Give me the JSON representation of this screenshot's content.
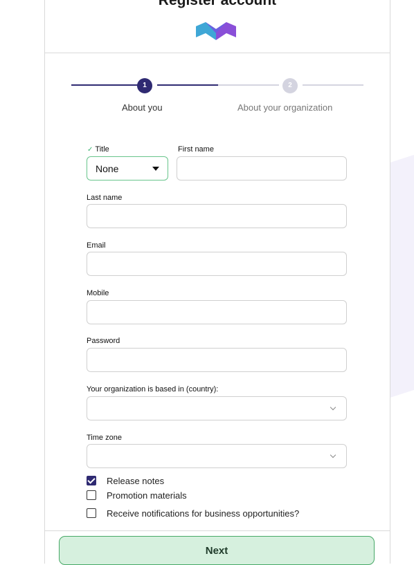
{
  "header": {
    "title": "Register account"
  },
  "steps": [
    {
      "number": "1",
      "label": "About you",
      "active": true
    },
    {
      "number": "2",
      "label": "About your organization",
      "active": false
    }
  ],
  "form": {
    "title_label": "Title",
    "title_value": "None",
    "first_name_label": "First name",
    "last_name_label": "Last name",
    "email_label": "Email",
    "mobile_label": "Mobile",
    "password_label": "Password",
    "country_label": "Your organization is based in (country):",
    "timezone_label": "Time zone"
  },
  "checkboxes": [
    {
      "label": "Release notes",
      "checked": true
    },
    {
      "label": "Promotion materials",
      "checked": false
    },
    {
      "label": "Receive notifications for business opportunities?",
      "checked": false
    }
  ],
  "footer": {
    "next_label": "Next"
  },
  "colors": {
    "primary": "#2f2a72",
    "accent_green": "#46a866",
    "button_bg": "#d6f0de",
    "inactive": "#d4d4e0"
  }
}
